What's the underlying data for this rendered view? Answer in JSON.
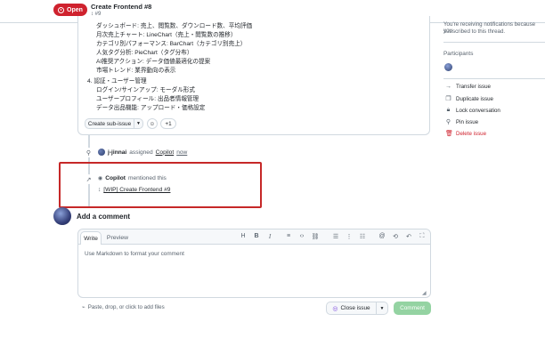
{
  "header": {
    "status_label": "Open",
    "title": "Create Frontend #8",
    "sub": "#9"
  },
  "issue_body": {
    "lines": [
      "ダッシュボード: 売上、閲覧数、ダウンロード数、平均評価",
      "月次売上チャート: LineChart（売上・閲覧数の推移）",
      "カテゴリ別パフォーマンス: BarChart（カテゴリ別売上）",
      "人気タグ分析: PieChart（タグ分布）",
      "AI推奨アクション: データ価値最適化の提案",
      "市場トレンド: 業界動向の表示"
    ],
    "section_heading": "4. 認証・ユーザー管理",
    "section_lines": [
      "ログイン/サインアップ: モーダル形式",
      "ユーザープロフィール: 出品者情報管理",
      "データ出品機能: アップロード・価格設定"
    ],
    "create_sub_issue_label": "Create sub-issue",
    "reaction_count": "+1"
  },
  "timeline": {
    "assign_actor": "j-jinnai",
    "assign_text": "assigned",
    "assign_target": "Copilot",
    "assign_time": "now",
    "mention_actor": "Copilot",
    "mention_text": "mentioned this",
    "mention_link": "[WIP] Create Frontend #9"
  },
  "composer": {
    "heading": "Add a comment",
    "tab_write": "Write",
    "tab_preview": "Preview",
    "placeholder": "Use Markdown to format your comment",
    "attach_hint": "Paste, drop, or click to add files",
    "close_issue_label": "Close issue",
    "comment_label": "Comment"
  },
  "sidebar": {
    "notification_text_1": "You're receiving notifications because you",
    "notification_text_2": "subscribed to this thread.",
    "participants_heading": "Participants",
    "actions": [
      {
        "label": "Transfer issue",
        "icon": "arrow-right-icon"
      },
      {
        "label": "Duplicate issue",
        "icon": "copy-icon"
      },
      {
        "label": "Lock conversation",
        "icon": "lock-icon"
      },
      {
        "label": "Pin issue",
        "icon": "pin-icon"
      },
      {
        "label": "Delete issue",
        "icon": "trash-icon",
        "color": "#cf222e"
      }
    ]
  },
  "colors": {
    "open": "#cf222e",
    "link": "#0969da",
    "highlight_box": "#c62828"
  }
}
